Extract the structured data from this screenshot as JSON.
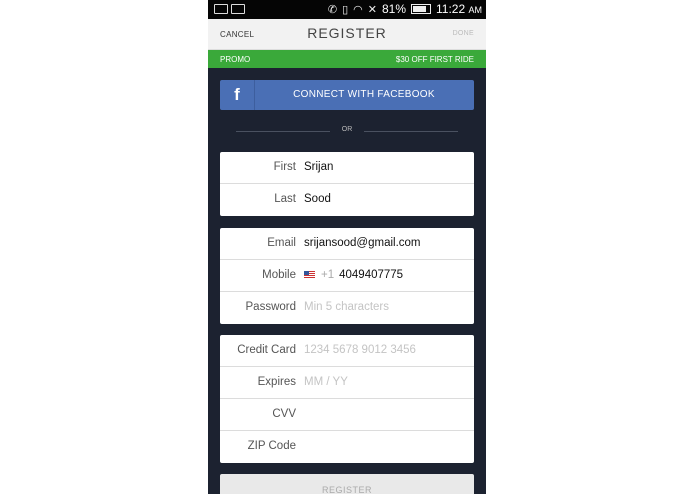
{
  "status": {
    "battery": "81%",
    "time": "11:22",
    "ampm": "AM"
  },
  "nav": {
    "cancel": "CANCEL",
    "title": "REGISTER",
    "done": "DONE"
  },
  "promo": {
    "label": "PROMO",
    "offer": "$30 OFF FIRST RIDE"
  },
  "facebook": {
    "icon_letter": "f",
    "label": "CONNECT WITH FACEBOOK"
  },
  "divider": {
    "label": "OR"
  },
  "name_card": [
    {
      "label": "First",
      "value": "Srijan"
    },
    {
      "label": "Last",
      "value": "Sood"
    }
  ],
  "account_card": {
    "email": {
      "label": "Email",
      "value": "srijansood@gmail.com"
    },
    "mobile": {
      "label": "Mobile",
      "country_code": "+1",
      "value": "4049407775"
    },
    "password": {
      "label": "Password",
      "placeholder": "Min 5 characters"
    }
  },
  "payment_card": {
    "credit_card": {
      "label": "Credit Card",
      "placeholder": "1234 5678 9012 3456"
    },
    "expires": {
      "label": "Expires",
      "placeholder": "MM / YY"
    },
    "cvv": {
      "label": "CVV",
      "value": ""
    },
    "zip": {
      "label": "ZIP Code",
      "value": ""
    }
  },
  "register_button": {
    "label": "REGISTER"
  }
}
